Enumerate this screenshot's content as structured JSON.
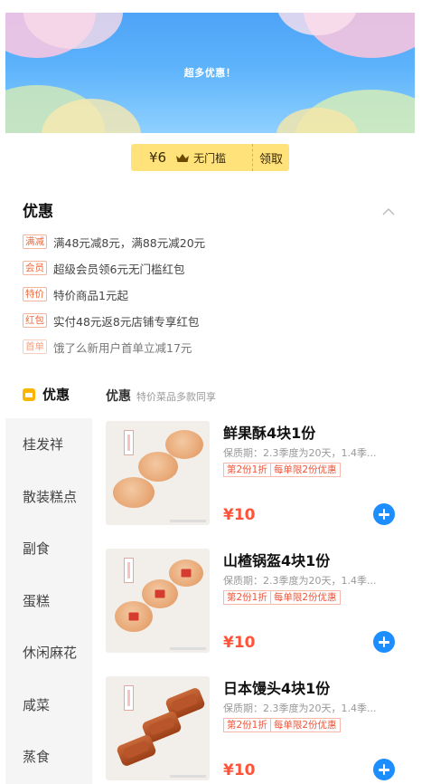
{
  "banner": {
    "title": "超多优惠！"
  },
  "coupon": {
    "amount": "¥6",
    "desc": "无门槛",
    "action": "领取"
  },
  "promo": {
    "title": "优惠",
    "items": [
      {
        "tag": "满减",
        "text": "满48元减8元，满88元减20元"
      },
      {
        "tag": "会员",
        "text": "超级会员领6元无门槛红包"
      },
      {
        "tag": "特价",
        "text": "特价商品1元起"
      },
      {
        "tag": "红包",
        "text": "实付48元返8元店铺专享红包"
      },
      {
        "tag": "首单",
        "text": "饿了么新用户首单立减17元"
      }
    ]
  },
  "category": {
    "active_label": "优惠",
    "section_name": "优惠",
    "section_sub": "特价菜品多款同享",
    "sidebar": [
      "桂发祥",
      "散装糕点",
      "副食",
      "蛋糕",
      "休闲麻花",
      "咸菜",
      "蒸食"
    ]
  },
  "products": [
    {
      "name": "鲜果酥4块1份",
      "desc": "保质期：2.3季度为20天，1.4季...",
      "tag1": "第2份1折",
      "tag2": "每单限2份优惠",
      "price": "¥10"
    },
    {
      "name": "山楂锅盔4块1份",
      "desc": "保质期：2.3季度为20天，1.4季...",
      "tag1": "第2份1折",
      "tag2": "每单限2份优惠",
      "price": "¥10"
    },
    {
      "name": "日本馒头4块1份",
      "desc": "保质期：2.3季度为20天，1.4季...",
      "tag1": "第2份1折",
      "tag2": "每单限2份优惠",
      "price": "¥10"
    }
  ],
  "colors": {
    "accent": "#1d8eff",
    "price": "#ff5339",
    "coupon": "#ffe27a",
    "tag": "#f06a3a"
  },
  "icons": [
    "crown-icon",
    "chevron-up-icon",
    "discount-icon",
    "plus-icon"
  ]
}
